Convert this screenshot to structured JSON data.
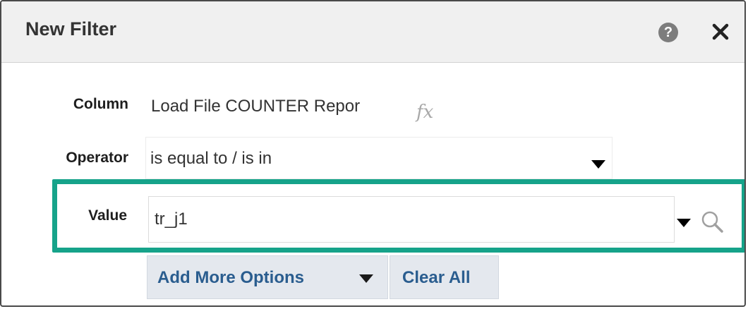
{
  "dialog": {
    "title": "New Filter",
    "help_glyph": "?",
    "icons": [
      "help-icon",
      "close-icon",
      "fx-icon",
      "chevron-down-icon",
      "search-icon"
    ]
  },
  "column": {
    "label": "Column",
    "value": "Load File COUNTER Repor",
    "fx_glyph": "fx"
  },
  "operator": {
    "label": "Operator",
    "value": "is equal to / is in"
  },
  "value_field": {
    "label": "Value",
    "value": "tr_j1"
  },
  "buttons": {
    "add_more_options": "Add More Options",
    "clear_all": "Clear All"
  },
  "colors": {
    "highlight_border": "#16a38a",
    "button_text": "#2a5d8f",
    "titlebar_bg": "#f0f0f0"
  }
}
